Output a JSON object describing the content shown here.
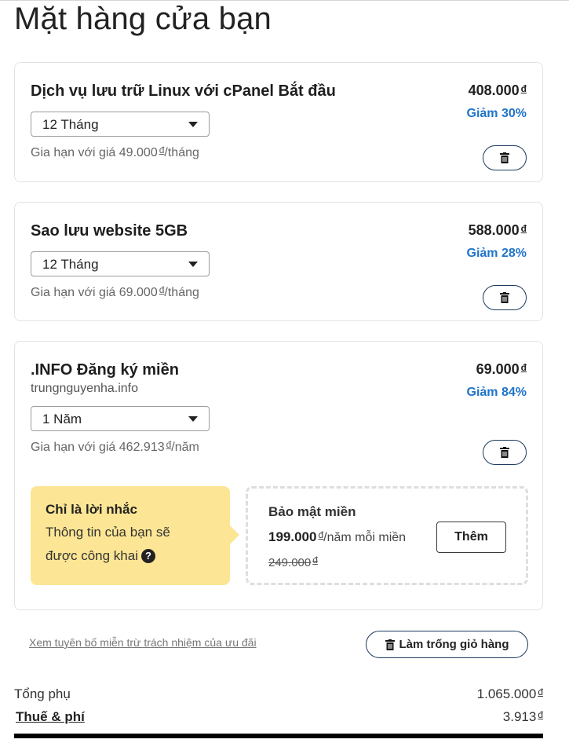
{
  "page": {
    "title": "Mặt hàng cửa bạn"
  },
  "currency_symbol": "đ",
  "items": [
    {
      "name": "Dịch vụ lưu trữ Linux với cPanel Bắt đầu",
      "term": "12 Tháng",
      "renew_prefix": "Gia hạn với giá 49.000",
      "renew_suffix": "/tháng",
      "price": "408.000",
      "discount": "Giảm 30%"
    },
    {
      "name": "Sao lưu website 5GB",
      "term": "12 Tháng",
      "renew_prefix": "Gia hạn với giá 69.000",
      "renew_suffix": "/tháng",
      "price": "588.000",
      "discount": "Giảm 28%"
    },
    {
      "name": ".INFO Đăng ký miền",
      "domain": "trungnguyenha.info",
      "term": "1 Năm",
      "renew_prefix": "Gia hạn với giá 462.913",
      "renew_suffix": "/năm",
      "price": "69.000",
      "discount": "Giảm 84%"
    }
  ],
  "reminder": {
    "title": "Chỉ là lời nhắc",
    "text": "Thông tin của bạn sẽ được công khai",
    "help_icon": "?"
  },
  "privacy_offer": {
    "title": "Bảo mật miền",
    "price": "199.000",
    "per_label": "/năm mỗi miền",
    "old_price": "249.000",
    "add_label": "Thêm"
  },
  "disclaimer_link": "Xem tuyên bố miễn trừ trách nhiệm của ưu đãi",
  "empty_cart_label": "Làm trống giỏ hàng",
  "summary": {
    "subtotal_label": "Tổng phụ",
    "subtotal_value": "1.065.000",
    "tax_label": "Thuế & phí",
    "tax_value": "3.913"
  },
  "icons": {
    "delete": "trash-icon",
    "dropdown": "chevron-down-icon",
    "help": "question-circle-icon"
  }
}
